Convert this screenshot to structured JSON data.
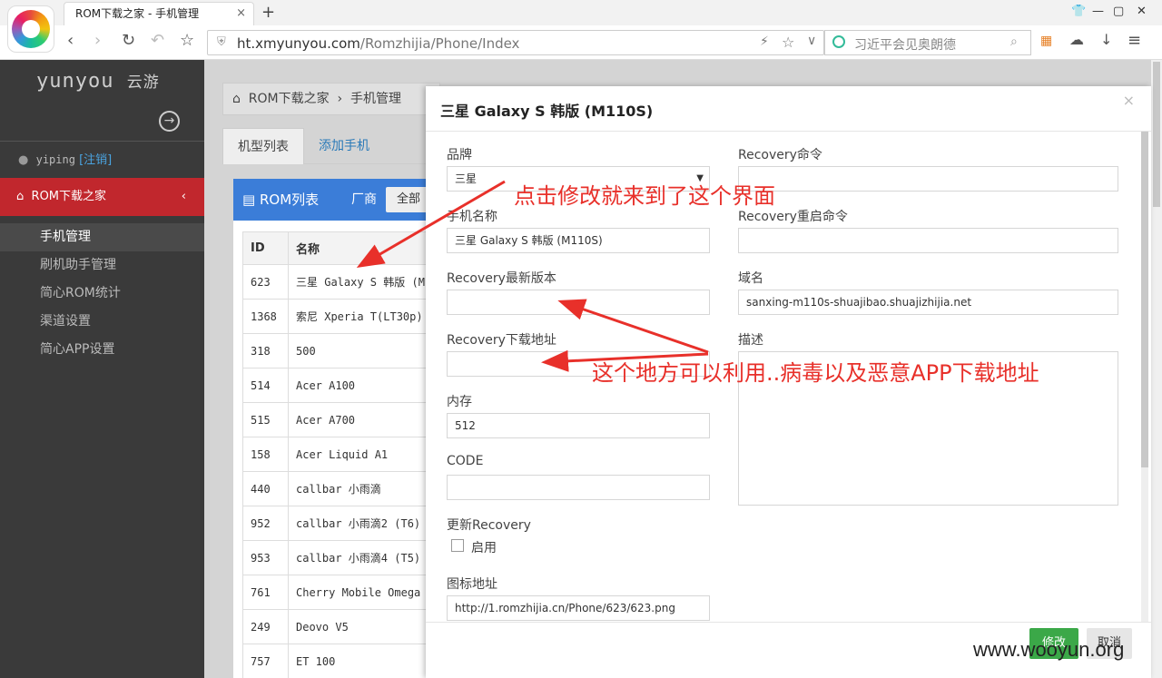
{
  "browser": {
    "tab_title": "ROM下载之家 - 手机管理",
    "tab_close": "×",
    "new_tab": "+",
    "url_host": "ht.xmyunyou.com",
    "url_path": "/Romzhijia/Phone/Index",
    "search_text": "习近平会见奥朗德"
  },
  "sidebar": {
    "brand": "yunyou",
    "brand_cn": "云游",
    "username": "yiping",
    "signout": "[注销]",
    "section": "ROM下载之家",
    "items": [
      "手机管理",
      "刷机助手管理",
      "简心ROM统计",
      "渠道设置",
      "简心APP设置"
    ]
  },
  "main": {
    "breadcrumb_home": "ROM下载之家",
    "breadcrumb_sep": "›",
    "breadcrumb_current": "手机管理",
    "tabs": [
      "机型列表",
      "添加手机"
    ],
    "panel_title": "ROM列表",
    "vendor_label": "厂商",
    "vendor_value": "全部",
    "table": {
      "headers": [
        "ID",
        "名称"
      ],
      "rows": [
        [
          "623",
          "三星 Galaxy S 韩版 (M"
        ],
        [
          "1368",
          "索尼 Xperia T(LT30p)"
        ],
        [
          "318",
          "500"
        ],
        [
          "514",
          "Acer A100"
        ],
        [
          "515",
          "Acer A700"
        ],
        [
          "158",
          "Acer Liquid A1"
        ],
        [
          "440",
          "callbar 小雨滴"
        ],
        [
          "952",
          "callbar 小雨滴2 (T6)"
        ],
        [
          "953",
          "callbar 小雨滴4 (T5)"
        ],
        [
          "761",
          "Cherry Mobile Omega H"
        ],
        [
          "249",
          "Deovo V5"
        ],
        [
          "757",
          "ET 100"
        ]
      ]
    }
  },
  "modal": {
    "title": "三星 Galaxy S 韩版 (M110S)",
    "close": "×",
    "brand_label": "品牌",
    "brand_value": "三星",
    "phone_name_label": "手机名称",
    "phone_name_value": "三星 Galaxy S 韩版 (M110S)",
    "recovery_version_label": "Recovery最新版本",
    "recovery_version_value": "",
    "recovery_download_label": "Recovery下载地址",
    "recovery_download_value": "",
    "memory_label": "内存",
    "memory_value": "512",
    "code_label": "CODE",
    "code_value": "",
    "update_recovery_label": "更新Recovery",
    "enable_label": "启用",
    "icon_url_label": "图标地址",
    "icon_url_value": "http://1.romzhijia.cn/Phone/623/623.png",
    "recovery_cmd_label": "Recovery命令",
    "recovery_cmd_value": "",
    "recovery_reboot_label": "Recovery重启命令",
    "recovery_reboot_value": "",
    "domain_label": "域名",
    "domain_value": "sanxing-m110s-shuajibao.shuajizhijia.net",
    "desc_label": "描述",
    "save_button": "修改",
    "cancel_button": "取消"
  },
  "annotations": {
    "note1": "点击修改就来到了这个界面",
    "note2": "这个地方可以利用..病毒以及恶意APP下载地址",
    "color": "#e8302a"
  },
  "watermark": "www.wooyun.org"
}
